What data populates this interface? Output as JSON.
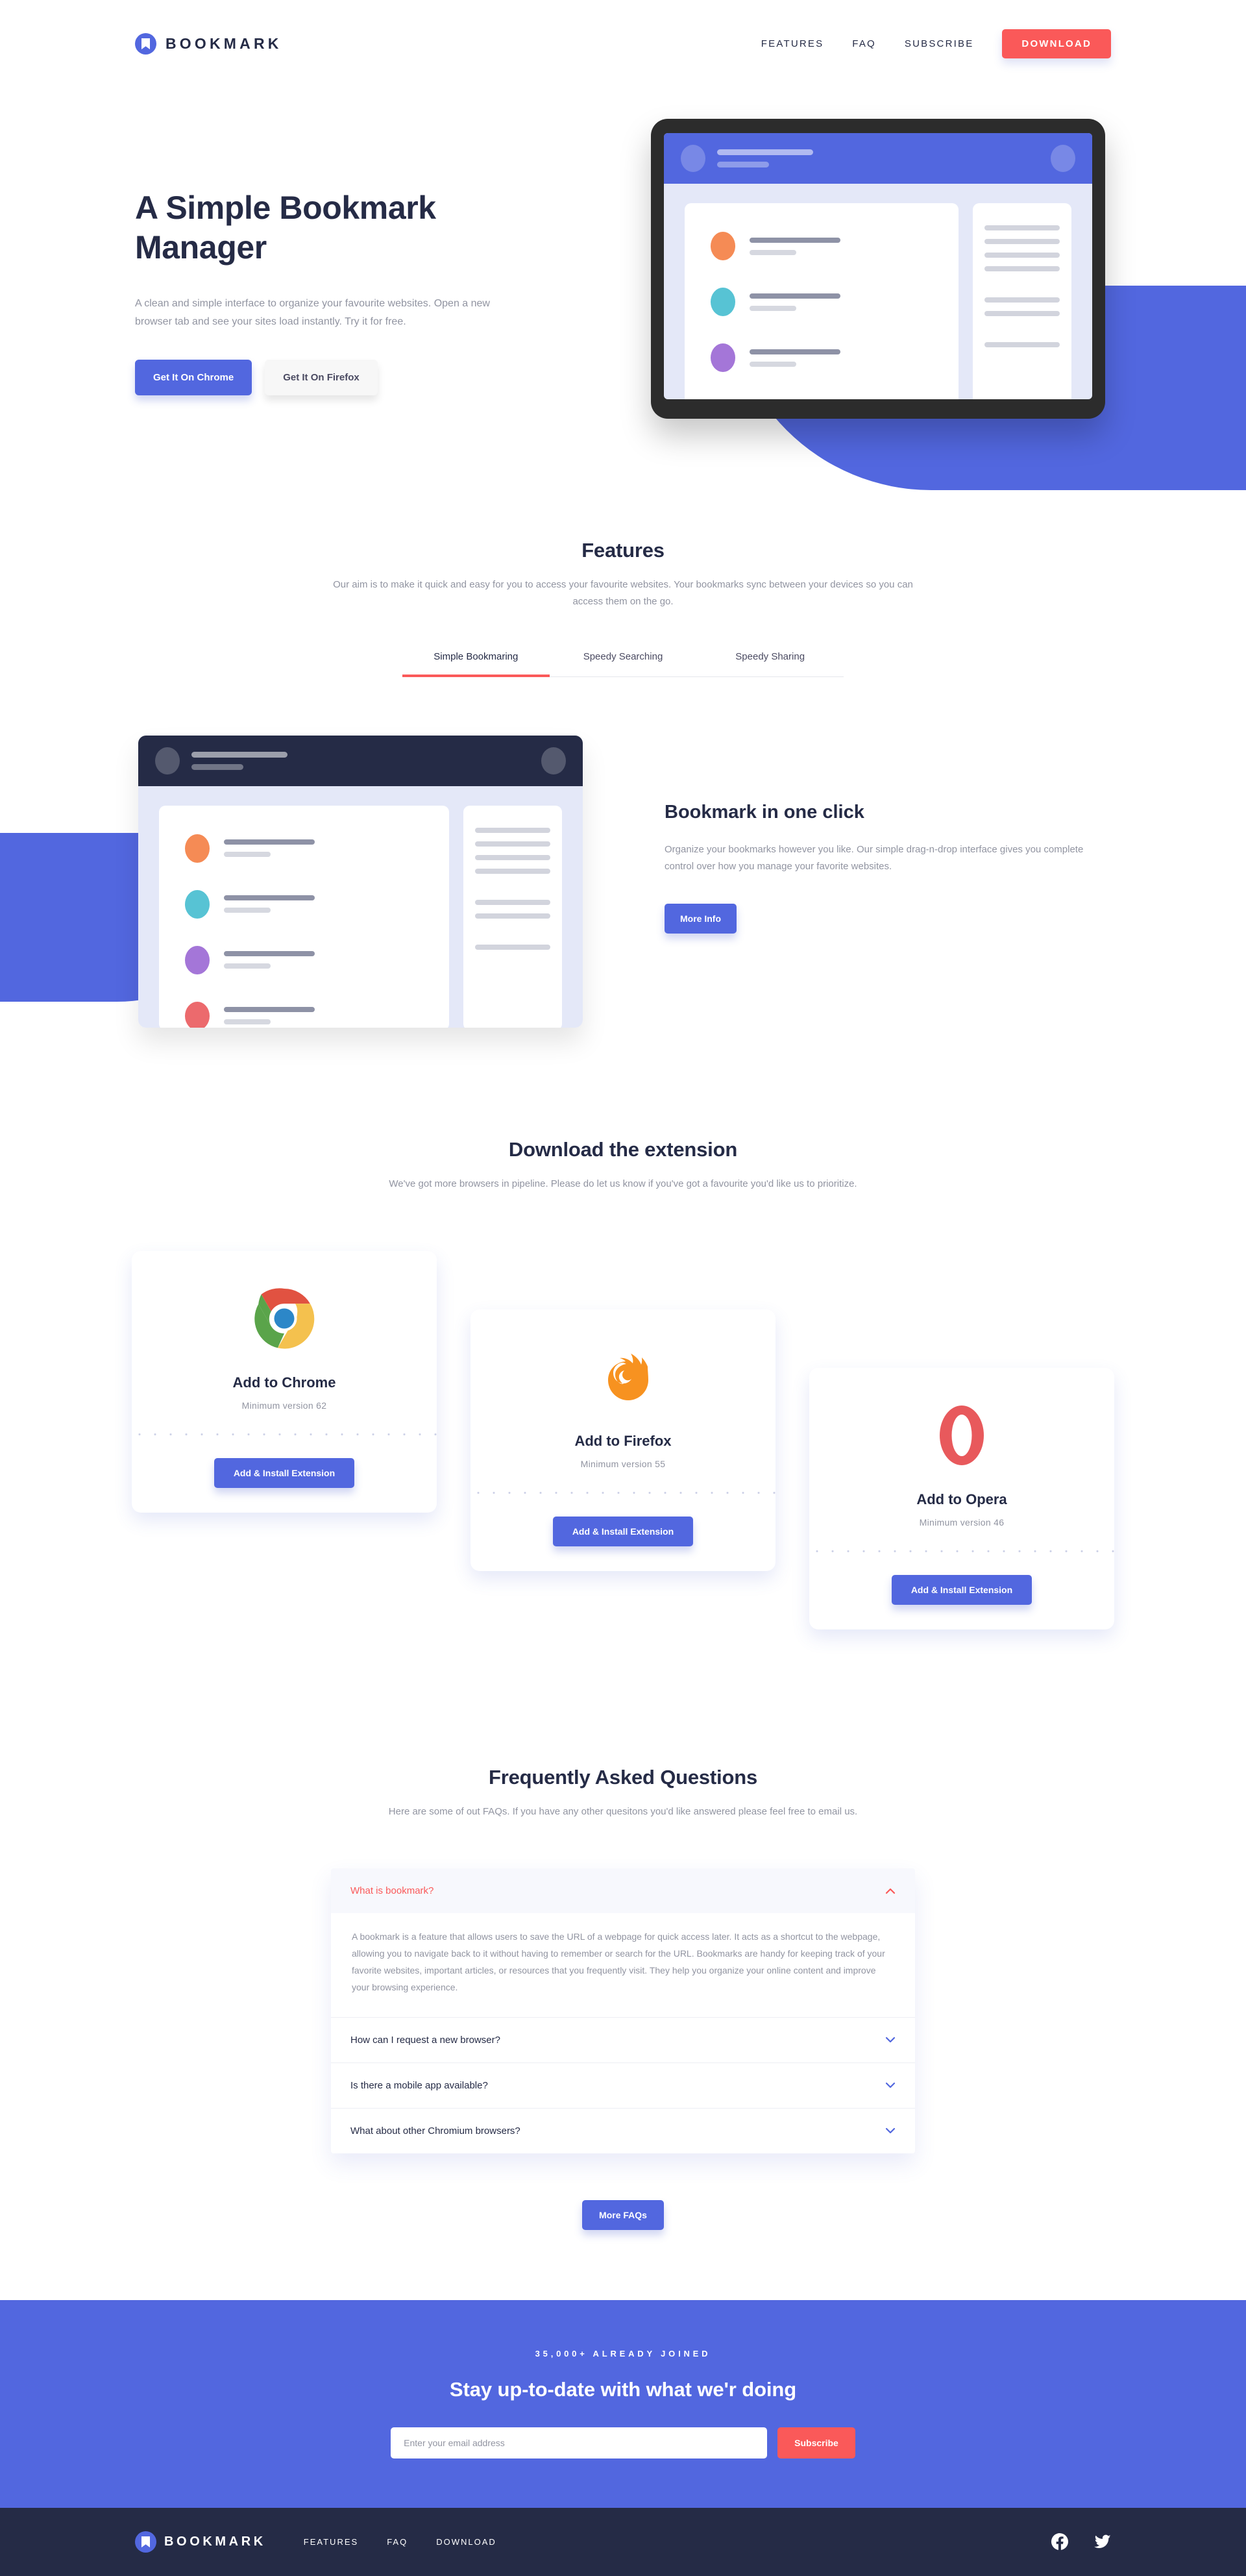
{
  "header": {
    "logo_text": "BOOKMARK",
    "logo_icon": "bookmark-icon",
    "nav": [
      {
        "label": "FEATURES"
      },
      {
        "label": "FAQ"
      },
      {
        "label": "SUBSCRIBE"
      }
    ],
    "download_button": "DOWNLOAD"
  },
  "hero": {
    "title": "A Simple Bookmark Manager",
    "subtitle": "A clean and simple interface to organize your favourite websites. Open a new browser tab and see your sites load instantly. Try it for free.",
    "btn_chrome": "Get It On Chrome",
    "btn_firefox": "Get It On Firefox"
  },
  "features": {
    "title": "Features",
    "description": "Our aim is to make it quick and easy for you to access your favourite websites. Your bookmarks sync between your devices so you can access them on the go.",
    "tabs": [
      {
        "label": "Simple Bookmaring",
        "active": true
      },
      {
        "label": "Speedy Searching",
        "active": false
      },
      {
        "label": "Speedy Sharing",
        "active": false
      }
    ],
    "panel": {
      "title": "Bookmark in one click",
      "description": "Organize your bookmarks however you like. Our simple drag-n-drop interface gives you complete control over how you manage your favorite websites.",
      "button": "More Info"
    }
  },
  "download": {
    "title": "Download the extension",
    "description": "We've got more browsers in pipeline. Please do let us know if you've got a favourite you'd like us to prioritize.",
    "cards": [
      {
        "name": "Add to Chrome",
        "version": "Minimum version 62",
        "button": "Add & Install Extension",
        "icon": "chrome-logo"
      },
      {
        "name": "Add to Firefox",
        "version": "Minimum version 55",
        "button": "Add & Install Extension",
        "icon": "firefox-logo"
      },
      {
        "name": "Add to Opera",
        "version": "Minimum version 46",
        "button": "Add & Install Extension",
        "icon": "opera-logo"
      }
    ]
  },
  "faq": {
    "title": "Frequently Asked Questions",
    "description": "Here are some of out FAQs. If you have any other quesitons you'd like answered please feel free to email us.",
    "items": [
      {
        "question": "What is bookmark?",
        "open": true,
        "answer": "A bookmark is a feature that allows users to save the URL of a webpage for quick access later. It acts as a shortcut to the webpage, allowing you to navigate back to it without having to remember or search for the URL. Bookmarks are handy for keeping track of your favorite websites, important articles, or resources that you frequently visit. They help you organize your online content and improve your browsing experience."
      },
      {
        "question": "How can I request a new browser?",
        "open": false,
        "answer": ""
      },
      {
        "question": "Is there a mobile app available?",
        "open": false,
        "answer": ""
      },
      {
        "question": "What about other Chromium browsers?",
        "open": false,
        "answer": ""
      }
    ],
    "more_button": "More FAQs"
  },
  "cta": {
    "kicker": "35,000+ ALREADY JOINED",
    "title": "Stay up-to-date with what we'r doing",
    "email_placeholder": "Enter your email address",
    "email_value": "",
    "subscribe_button": "Subscribe"
  },
  "footer": {
    "logo_text": "BOOKMARK",
    "nav": [
      {
        "label": "FEATURES"
      },
      {
        "label": "FAQ"
      },
      {
        "label": "DOWNLOAD"
      }
    ],
    "social": [
      {
        "name": "facebook-icon"
      },
      {
        "name": "twitter-icon"
      }
    ]
  },
  "colors": {
    "brand_blue": "#5267df",
    "accent_red": "#fa5959",
    "dark_navy": "#252b46",
    "grey_text": "#9194a1"
  }
}
